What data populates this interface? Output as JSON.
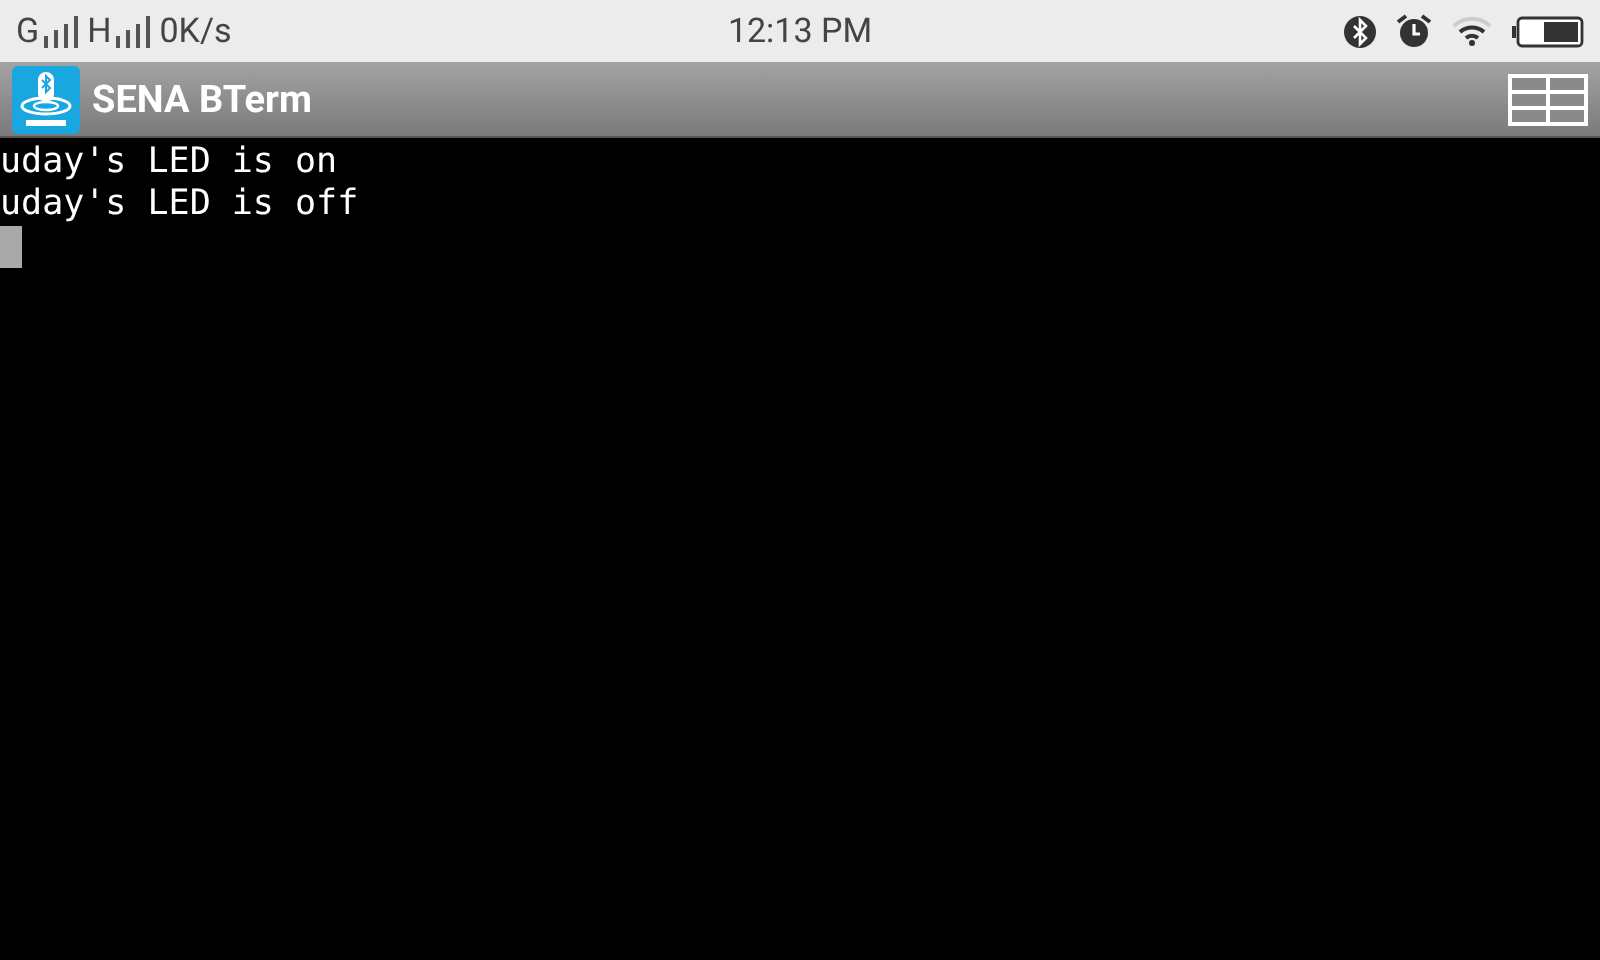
{
  "status_bar": {
    "network_1": "G",
    "network_2": "H",
    "speed": "0K/s",
    "time": "12:13 PM"
  },
  "app_bar": {
    "title": "SENA BTerm"
  },
  "terminal": {
    "lines": [
      "uday's LED is on",
      "uday's LED is off"
    ]
  }
}
